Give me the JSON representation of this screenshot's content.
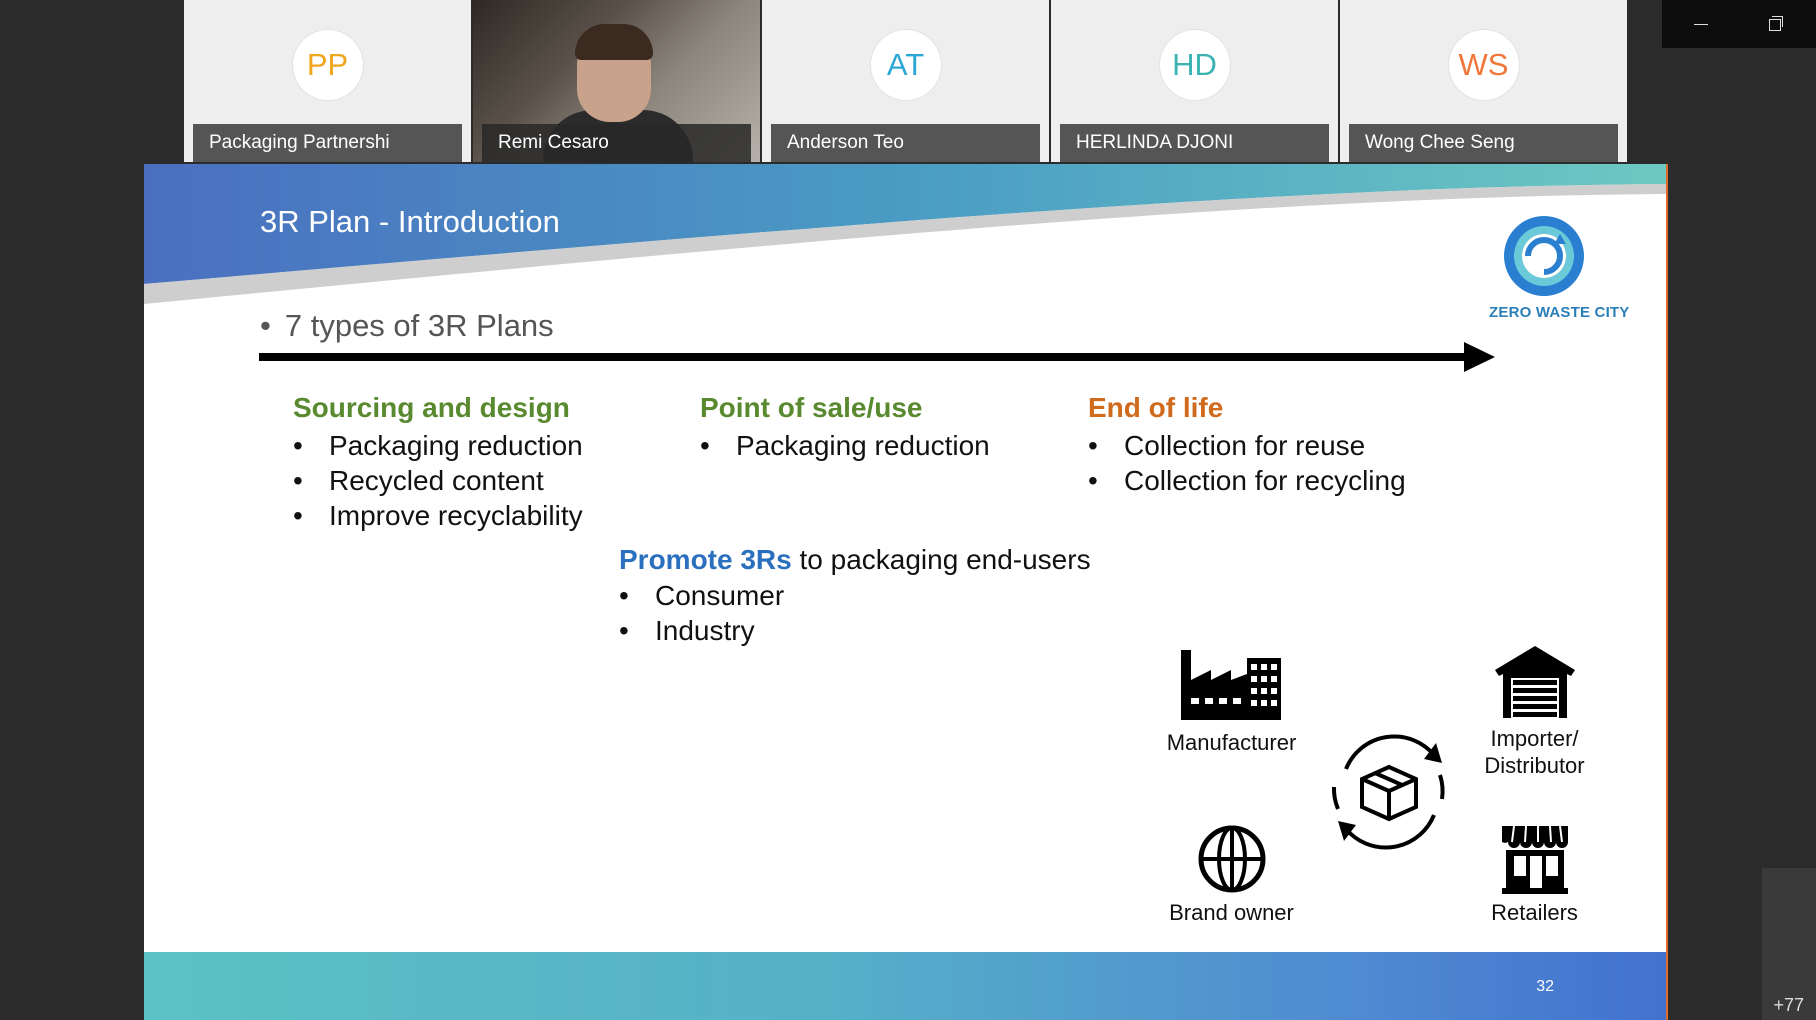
{
  "participants": [
    {
      "initials": "PP",
      "name": "Packaging Partnershi",
      "color": "#f0a61d",
      "video": false
    },
    {
      "initials": "",
      "name": "Remi Cesaro",
      "color": "",
      "video": true
    },
    {
      "initials": "AT",
      "name": "Anderson Teo",
      "color": "#2ba7d6",
      "video": false
    },
    {
      "initials": "HD",
      "name": "HERLINDA DJONI",
      "color": "#3bb3b3",
      "video": false
    },
    {
      "initials": "WS",
      "name": "Wong Chee Seng",
      "color": "#f0763a",
      "video": false
    }
  ],
  "slide": {
    "title": "3R Plan - Introduction",
    "logo_text": "ZERO WASTE CITY",
    "intro": "7 types of 3R Plans",
    "columns": [
      {
        "heading": "Sourcing and design",
        "color": "#5a8a2f",
        "items": [
          "Packaging reduction",
          "Recycled content",
          "Improve recyclability"
        ]
      },
      {
        "heading": "Point of sale/use",
        "color": "#5a8a2f",
        "items": [
          "Packaging reduction"
        ]
      },
      {
        "heading": "End of life",
        "color": "#d06a1c",
        "items": [
          "Collection for reuse",
          "Collection for recycling"
        ]
      }
    ],
    "promote": {
      "keyword": "Promote 3Rs",
      "rest": " to packaging end-users",
      "items": [
        "Consumer",
        "Industry"
      ]
    },
    "stakeholders": {
      "manufacturer": "Manufacturer",
      "importer_line1": "Importer/",
      "importer_line2": "Distributor",
      "brand_owner": "Brand owner",
      "retailers": "Retailers"
    },
    "page_number": "32"
  },
  "overflow_count": "+77",
  "icons": [
    "factory-icon",
    "warehouse-icon",
    "recycle-box-icon",
    "globe-icon",
    "store-icon",
    "minimize-icon",
    "restore-icon"
  ]
}
